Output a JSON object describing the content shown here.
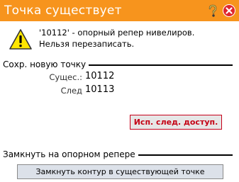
{
  "dialog": {
    "title": "Точка существует",
    "message_line1": "'10112' - опорный репер нивелиров.",
    "message_line2": "Нельзя перезаписать."
  },
  "save_section": {
    "title": "Сохр. новую точку",
    "existing_label": "Сущес.:",
    "existing_value": "10112",
    "next_label": "След",
    "next_value": "10113",
    "use_next_button": "Исп. след. доступ."
  },
  "close_section": {
    "title": "Замкнуть на опорном репере",
    "close_button": "Замкнуть контур в существующей точке"
  },
  "colors": {
    "titlebar": "#f7941d",
    "accent_red": "#c40014"
  },
  "icons": [
    "help-icon",
    "close-icon",
    "warning-icon"
  ]
}
